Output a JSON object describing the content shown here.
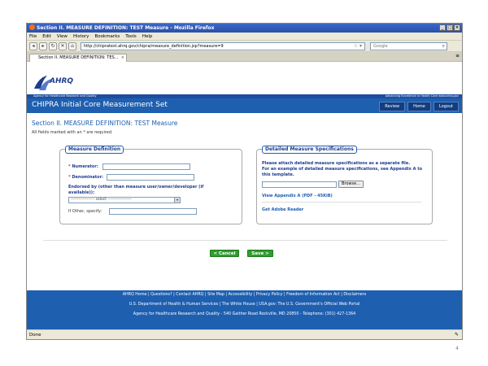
{
  "window": {
    "title": "Section II. MEASURE DEFINITION: TEST Measure - Mozilla Firefox"
  },
  "menu": [
    "File",
    "Edit",
    "View",
    "History",
    "Bookmarks",
    "Tools",
    "Help"
  ],
  "address": {
    "url": "http://chipratest.ahrq.gov/chipra/measure_definition.jsp?measure=9"
  },
  "search": {
    "placeholder": "Google"
  },
  "tab": {
    "label": "Section II. MEASURE DEFINITION: TES..."
  },
  "header": {
    "logo_text": "AHRQ",
    "tagline": "Agency for Healthcare Research and Quality",
    "right_text": "Advancing Excellence in Health Care   www.ahrq.gov"
  },
  "app": {
    "title": "CHIPRA Initial Core Measurement Set",
    "nav": [
      "Review",
      "Home",
      "Logout"
    ]
  },
  "section": {
    "title": "Section II. MEASURE DEFINITION: TEST Measure",
    "required_note": "All fields marked with an * are required."
  },
  "measure_definition": {
    "legend": "Measure Definition",
    "numerator_label": "Numerator:",
    "denominator_label": "Denominator:",
    "endorsed_label_line1": "Endorsed by (other than measure user/owner/developer (if",
    "endorsed_label_line2": "available)):",
    "select_value": "------------------ select ------------------",
    "other_label": "If Other, specify:"
  },
  "detailed_specs": {
    "legend": "Detailed Measure Specifications",
    "line1": "Please attach detailed measure specifications as a separate file.",
    "line2": "For an example of detailed measure specifications, see Appendix A to",
    "line3": "this template.",
    "browse": "Browse...",
    "appendix_link": "View Appendix A (PDF - 45KiB)",
    "adobe_link": "Get Adobe Reader"
  },
  "actions": {
    "cancel": "< Cancel",
    "save": "Save >"
  },
  "footer": {
    "line1": "AHRQ Home | Questions? | Contact AHRQ | Site Map | Accessibility | Privacy Policy | Freedom of Information Act | Disclaimers",
    "line2": "U.S. Department of Health & Human Services | The White House | USA.gov: The U.S. Government's Official Web Portal",
    "line3": "Agency for Healthcare Research and Quality - 540 Gaither Road Rockville, MD 20850 - Telephone: (301) 427-1364"
  },
  "status": {
    "text": "Done"
  },
  "slide": {
    "page_number": "4"
  }
}
